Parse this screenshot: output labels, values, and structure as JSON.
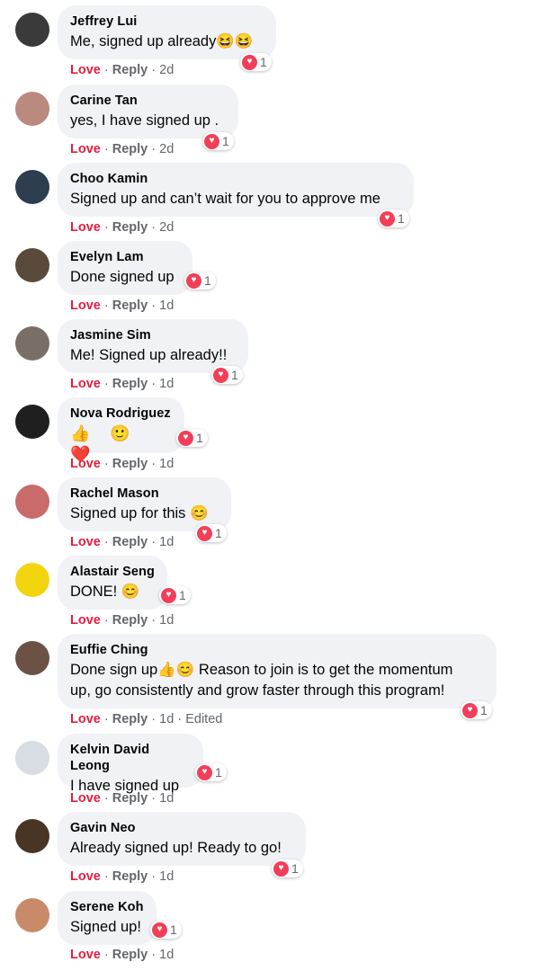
{
  "actions": {
    "love": "Love",
    "reply": "Reply",
    "sep": "·"
  },
  "comments": [
    {
      "name": "Jeffrey Lui",
      "text": "Me, signed up already😆😆",
      "time": "2d",
      "edited": "",
      "reactions": "1",
      "avatar_color": "#3a3a3a"
    },
    {
      "name": "Carine Tan",
      "text": "yes, I have signed up .",
      "time": "2d",
      "edited": "",
      "reactions": "1",
      "avatar_color": "#b98a7d"
    },
    {
      "name": "Choo Kamin",
      "text": "Signed up and can’t wait for you to approve me",
      "time": "2d",
      "edited": "",
      "reactions": "1",
      "avatar_color": "#2c3e50"
    },
    {
      "name": "Evelyn Lam",
      "text": "Done signed up",
      "time": "1d",
      "edited": "",
      "reactions": "1",
      "avatar_color": "#5a4a3a"
    },
    {
      "name": "Jasmine Sim",
      "text": "Me! Signed up already!!",
      "time": "1d",
      "edited": "",
      "reactions": "1",
      "avatar_color": "#7a6f66"
    },
    {
      "name": "Nova Rodriguez",
      "text": "👍 🙂 ❤️",
      "time": "1d",
      "edited": "",
      "reactions": "1",
      "avatar_color": "#1f1f1f"
    },
    {
      "name": "Rachel Mason",
      "text": "Signed up for this 😊",
      "time": "1d",
      "edited": "",
      "reactions": "1",
      "avatar_color": "#c96b6b"
    },
    {
      "name": "Alastair Seng",
      "text": "DONE! 😊",
      "time": "1d",
      "edited": "",
      "reactions": "1",
      "avatar_color": "#f2d50f"
    },
    {
      "name": "Euffie Ching",
      "text": "Done sign up👍😊 Reason to join is to get the momentum\nup, go consistently and grow faster through this program!",
      "time": "1d",
      "edited": "Edited",
      "reactions": "1",
      "avatar_color": "#6b5245"
    },
    {
      "name": "Kelvin David Leong",
      "text": "I have signed up",
      "time": "1d",
      "edited": "",
      "reactions": "1",
      "avatar_color": "#d8dce3"
    },
    {
      "name": "Gavin Neo",
      "text": "Already signed up! Ready to go!",
      "time": "1d",
      "edited": "",
      "reactions": "1",
      "avatar_color": "#4a3424"
    },
    {
      "name": "Serene Koh",
      "text": "Signed up!",
      "time": "1d",
      "edited": "",
      "reactions": "1",
      "avatar_color": "#c98a6a"
    }
  ]
}
